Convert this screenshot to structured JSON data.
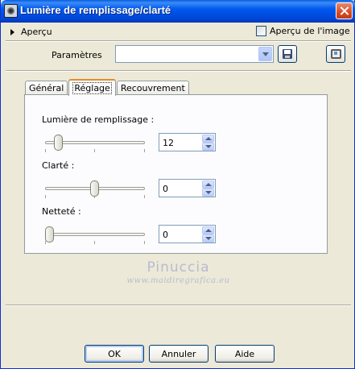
{
  "window": {
    "title": "Lumière de remplissage/clarté"
  },
  "preview": {
    "toggle_label": "Aperçu",
    "image_preview_label": "Aperçu de l'image",
    "image_preview_checked": false
  },
  "params": {
    "label": "Paramètres",
    "selected_value": ""
  },
  "tabs": [
    {
      "label": "Général",
      "active": false
    },
    {
      "label": "Réglage",
      "active": true
    },
    {
      "label": "Recouvrement",
      "active": false
    }
  ],
  "controls": {
    "fill_light": {
      "label": "Lumière de remplissage :",
      "value": "12"
    },
    "clarity": {
      "label": "Clarté :",
      "value": "0"
    },
    "sharpness": {
      "label": "Netteté :",
      "value": "0"
    }
  },
  "watermark": {
    "name": "Pinuccia",
    "url": "www.maidiregrafica.eu"
  },
  "buttons": {
    "ok": "OK",
    "cancel": "Annuler",
    "help": "Aide"
  }
}
